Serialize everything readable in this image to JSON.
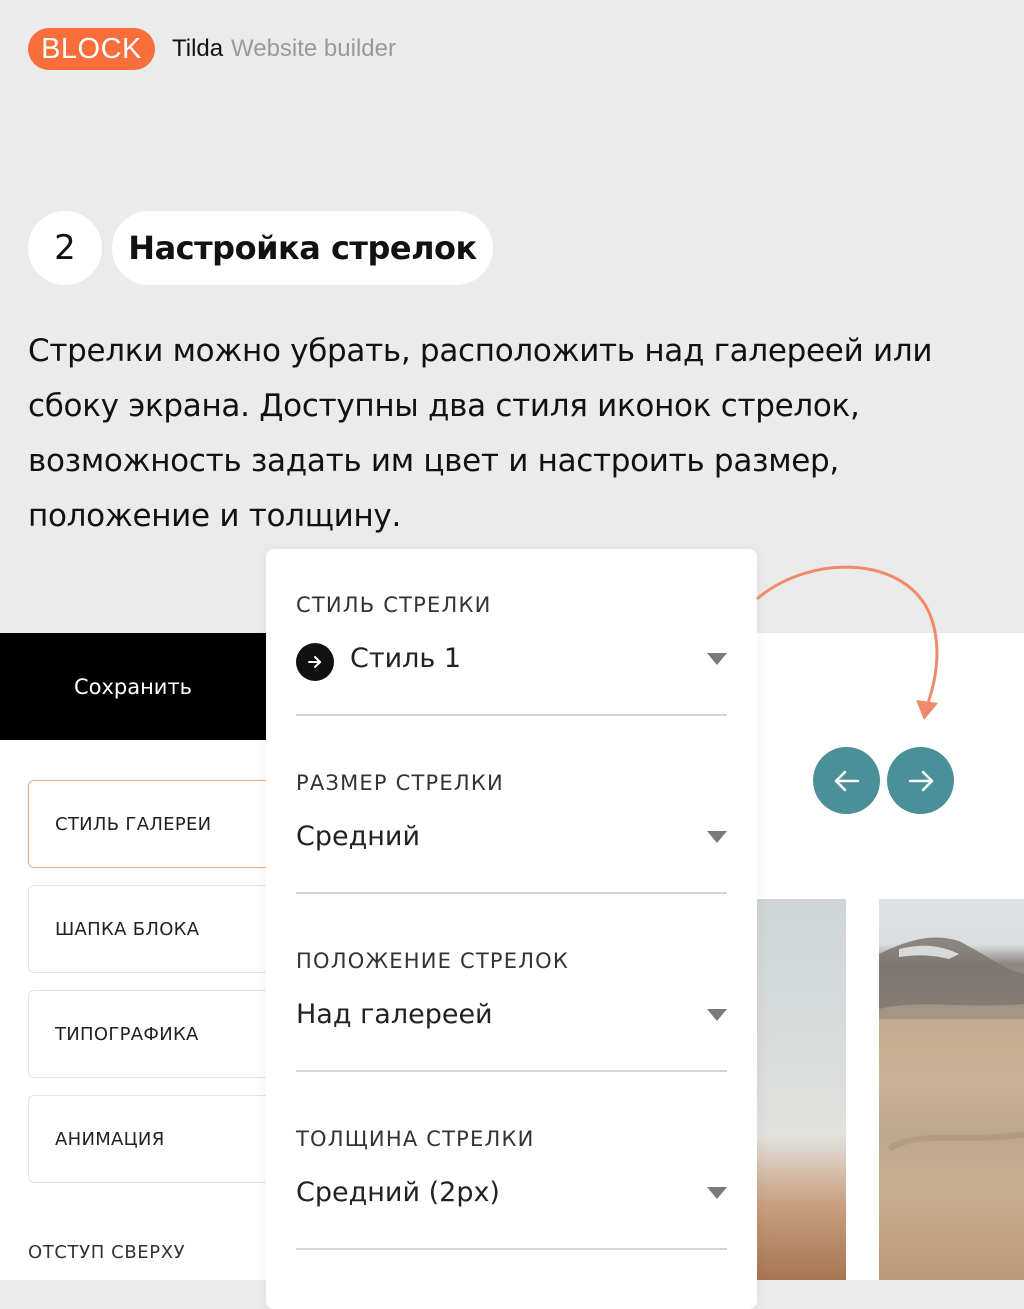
{
  "header": {
    "badge": "BLOCK",
    "brand": "Tilda",
    "tagline": "Website builder"
  },
  "step": {
    "number": "2",
    "title": "Настройка стрелок"
  },
  "description": "Стрелки можно убрать, расположить над галереей или сбоку экрана. Доступны два стиля иконок стрелок, возможность задать им цвет и настроить размер, положение и толщину.",
  "editor": {
    "save_label": "Сохранить",
    "menu": [
      {
        "label": "СТИЛЬ ГАЛЕРЕИ",
        "active": true
      },
      {
        "label": "ШАПКА БЛОКА",
        "active": false
      },
      {
        "label": "ТИПОГРАФИКА",
        "active": false
      },
      {
        "label": "АНИМАЦИЯ",
        "active": false
      }
    ],
    "section_label": "ОТСТУП СВЕРХУ"
  },
  "panel": {
    "fields": [
      {
        "label": "СТИЛЬ СТРЕЛКИ",
        "value": "Стиль 1",
        "icon": "arrow-right-circle-icon"
      },
      {
        "label": "РАЗМЕР СТРЕЛКИ",
        "value": "Средний"
      },
      {
        "label": "ПОЛОЖЕНИЕ СТРЕЛОК",
        "value": "Над галереей"
      },
      {
        "label": "ТОЛЩИНА СТРЕЛКИ",
        "value": "Средний (2px)"
      }
    ]
  },
  "colors": {
    "accent": "#fa6e3c",
    "arrow_button": "#4b8f99",
    "curve": "#f08a6a"
  },
  "icons": {
    "prev": "arrow-left-icon",
    "next": "arrow-right-icon"
  }
}
